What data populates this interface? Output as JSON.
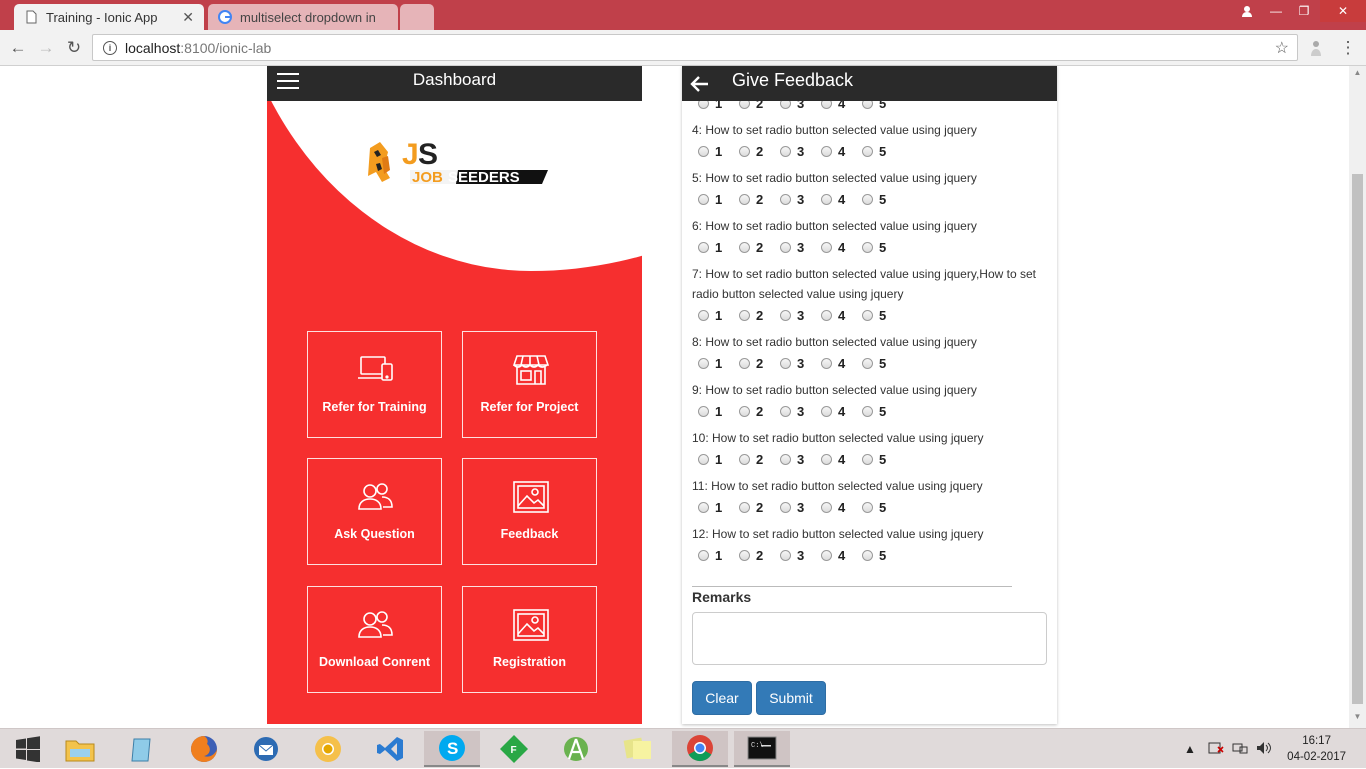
{
  "browser": {
    "tabs": [
      {
        "title": "Training - Ionic App"
      },
      {
        "title": "multiselect dropdown in"
      }
    ],
    "url_host": "localhost",
    "url_path": ":8100/ionic-lab"
  },
  "dashboard": {
    "title": "Dashboard",
    "logo_text": "JOBSEEDERS",
    "tiles": [
      {
        "label": "Refer for Training",
        "icon": "devices-icon"
      },
      {
        "label": "Refer for Project",
        "icon": "storefront-icon"
      },
      {
        "label": "Ask Question",
        "icon": "people-icon"
      },
      {
        "label": "Feedback",
        "icon": "image-icon"
      },
      {
        "label": "Download Conrent",
        "icon": "people-icon"
      },
      {
        "label": "Registration",
        "icon": "image-icon"
      }
    ]
  },
  "feedback": {
    "title": "Give Feedback",
    "options": [
      "1",
      "2",
      "3",
      "4",
      "5"
    ],
    "questions": [
      {
        "text": "4: How to set radio button selected value using jquery"
      },
      {
        "text": "5: How to set radio button selected value using jquery"
      },
      {
        "text": "6: How to set radio button selected value using jquery"
      },
      {
        "text": "7: How to set radio button selected value using jquery,How to set radio button selected value using jquery"
      },
      {
        "text": "8: How to set radio button selected value using jquery"
      },
      {
        "text": "9: How to set radio button selected value using jquery"
      },
      {
        "text": "10: How to set radio button selected value using jquery"
      },
      {
        "text": "11: How to set radio button selected value using jquery"
      },
      {
        "text": "12: How to set radio button selected value using jquery"
      }
    ],
    "remarks_label": "Remarks",
    "remarks_value": "",
    "clear_label": "Clear",
    "submit_label": "Submit"
  },
  "taskbar": {
    "time": "16:17",
    "date": "04-02-2017"
  }
}
